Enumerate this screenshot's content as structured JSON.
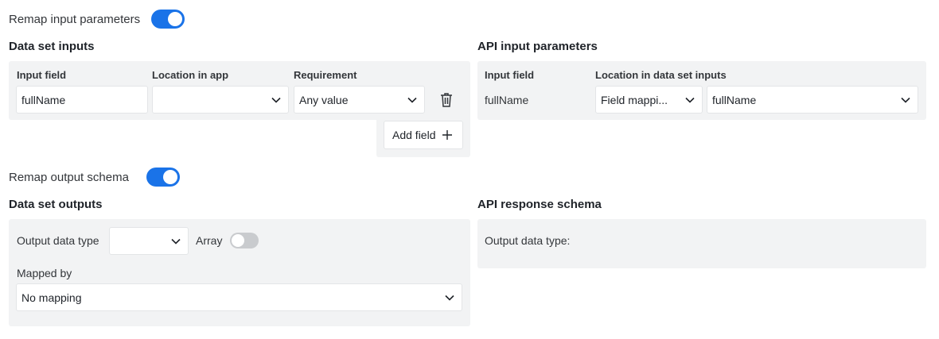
{
  "input_remap": {
    "label": "Remap input parameters",
    "enabled": true
  },
  "dataset_inputs": {
    "title": "Data set inputs",
    "headers": {
      "input_field": "Input field",
      "location": "Location in app",
      "requirement": "Requirement"
    },
    "row": {
      "input_field": "fullName",
      "location": "",
      "requirement": "Any value"
    },
    "add_field_label": "Add field"
  },
  "api_inputs": {
    "title": "API input parameters",
    "headers": {
      "input_field": "Input field",
      "location": "Location in data set inputs"
    },
    "row": {
      "input_field": "fullName",
      "location_type": "Field mappi...",
      "location_value": "fullName"
    }
  },
  "output_remap": {
    "label": "Remap output schema",
    "enabled": true
  },
  "dataset_outputs": {
    "title": "Data set outputs",
    "output_type_label": "Output data type",
    "output_type_value": "",
    "array_label": "Array",
    "array_enabled": false,
    "mapped_by_label": "Mapped by",
    "mapped_by_value": "No mapping"
  },
  "api_response": {
    "title": "API response schema",
    "output_type_label": "Output data type:"
  },
  "colors": {
    "accent": "#1a73e8",
    "panel": "#f2f3f4",
    "toggle_off": "#c9cbce"
  },
  "icons": {
    "chevron": "chevron-down-icon",
    "trash": "trash-icon",
    "plus": "plus-icon"
  }
}
